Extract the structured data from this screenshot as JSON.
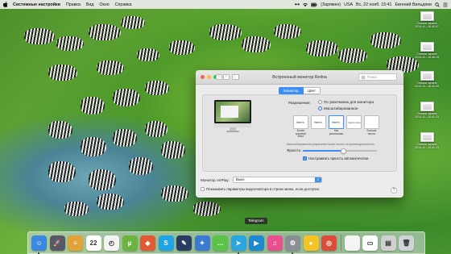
{
  "menubar": {
    "app_name": "Системные настройки",
    "menus": [
      "Правка",
      "Вид",
      "Окно",
      "Справка"
    ],
    "battery": "(Заряжен)",
    "input_lang": "USA",
    "datetime": "Вс, 22 нояб.  15:41",
    "user": "Евгений Вильдяев"
  },
  "desktop": {
    "icons": [
      {
        "name": "Снимок экрана\n2015-11...16.40.57"
      },
      {
        "name": "Снимок экрана\n2015-11...16.46.19"
      },
      {
        "name": "Снимок экрана\n2015-11...16.40.09"
      },
      {
        "name": "Снимок экрана\n2015-11...15.41.33"
      },
      {
        "name": "Снимок экрана\n2015-11...15.41.33"
      }
    ]
  },
  "window": {
    "title": "Встроенный монитор Retina",
    "search_placeholder": "Поиск",
    "tabs": [
      "Монитор",
      "Цвет"
    ],
    "active_tab": "Монитор",
    "resolution_label": "Разрешение:",
    "resolution_options": [
      "По умолчанию для монитора",
      "Масштабированное"
    ],
    "resolution_selected": "Масштабированное",
    "scale_options": [
      {
        "preview": "Here's",
        "label": "Более\nкрупный текст"
      },
      {
        "preview": "Here's",
        "label": ""
      },
      {
        "preview": "Here's",
        "label": "Как\nумолчанию"
      },
      {
        "preview": "Here's more",
        "label": ""
      },
      {
        "preview": "",
        "label": "Больше\nместа"
      }
    ],
    "scale_selected_index": 2,
    "scale_note": "Масштабированное разрешение может влиять на производительность.",
    "brightness_label": "Яркость:",
    "brightness_level": 0.55,
    "auto_brightness_label": "Настраивать яркость автоматически",
    "auto_brightness_checked": true,
    "airplay_label": "Монитор AirPlay:",
    "airplay_value": "Выкл.",
    "mirror_label": "Показывать параметры видеоповтора в строке меню, если доступно",
    "mirror_checked": false,
    "help_glyph": "?"
  },
  "tooltip": "Telegram",
  "dock": {
    "apps": [
      {
        "name": "finder-icon",
        "glyph": "☺",
        "color": "#3b88e0"
      },
      {
        "name": "launchpad-icon",
        "glyph": "🚀",
        "color": "#555a66"
      },
      {
        "name": "notes-icon",
        "glyph": "≡",
        "color": "#e0a33a"
      },
      {
        "name": "calendar-icon",
        "glyph": "22",
        "color": "#ffffff"
      },
      {
        "name": "clock-icon",
        "glyph": "◴",
        "color": "#f4f4f4"
      },
      {
        "name": "utorrent-icon",
        "glyph": "µ",
        "color": "#6cb33f"
      },
      {
        "name": "game-icon",
        "glyph": "◆",
        "color": "#e05a33"
      },
      {
        "name": "skype-icon",
        "glyph": "S",
        "color": "#1fa5e6"
      },
      {
        "name": "quill-icon",
        "glyph": "✎",
        "color": "#2a3b64"
      },
      {
        "name": "compass-icon",
        "glyph": "✦",
        "color": "#3a7ad0"
      },
      {
        "name": "messages-icon",
        "glyph": "…",
        "color": "#5bc24a"
      },
      {
        "name": "telegram-icon",
        "glyph": "➤",
        "color": "#2ba5de"
      },
      {
        "name": "player-icon",
        "glyph": "▶",
        "color": "#1e88d0"
      },
      {
        "name": "itunes-icon",
        "glyph": "♫",
        "color": "#e94f8f"
      },
      {
        "name": "settings-icon",
        "glyph": "⚙",
        "color": "#8a8f96"
      },
      {
        "name": "duck-icon",
        "glyph": "●",
        "color": "#f6c325"
      },
      {
        "name": "chrome-icon",
        "glyph": "◎",
        "color": "#dd4b39"
      }
    ],
    "right_items": [
      {
        "name": "document-icon",
        "glyph": "",
        "color": "#f4f4f4"
      },
      {
        "name": "screenshots-icon",
        "glyph": "▭",
        "color": "#ffffff"
      },
      {
        "name": "stack-icon",
        "glyph": "▤",
        "color": "#d0d0d0"
      },
      {
        "name": "trash-icon",
        "glyph": "🗑",
        "color": "#cfd4d8"
      }
    ]
  }
}
